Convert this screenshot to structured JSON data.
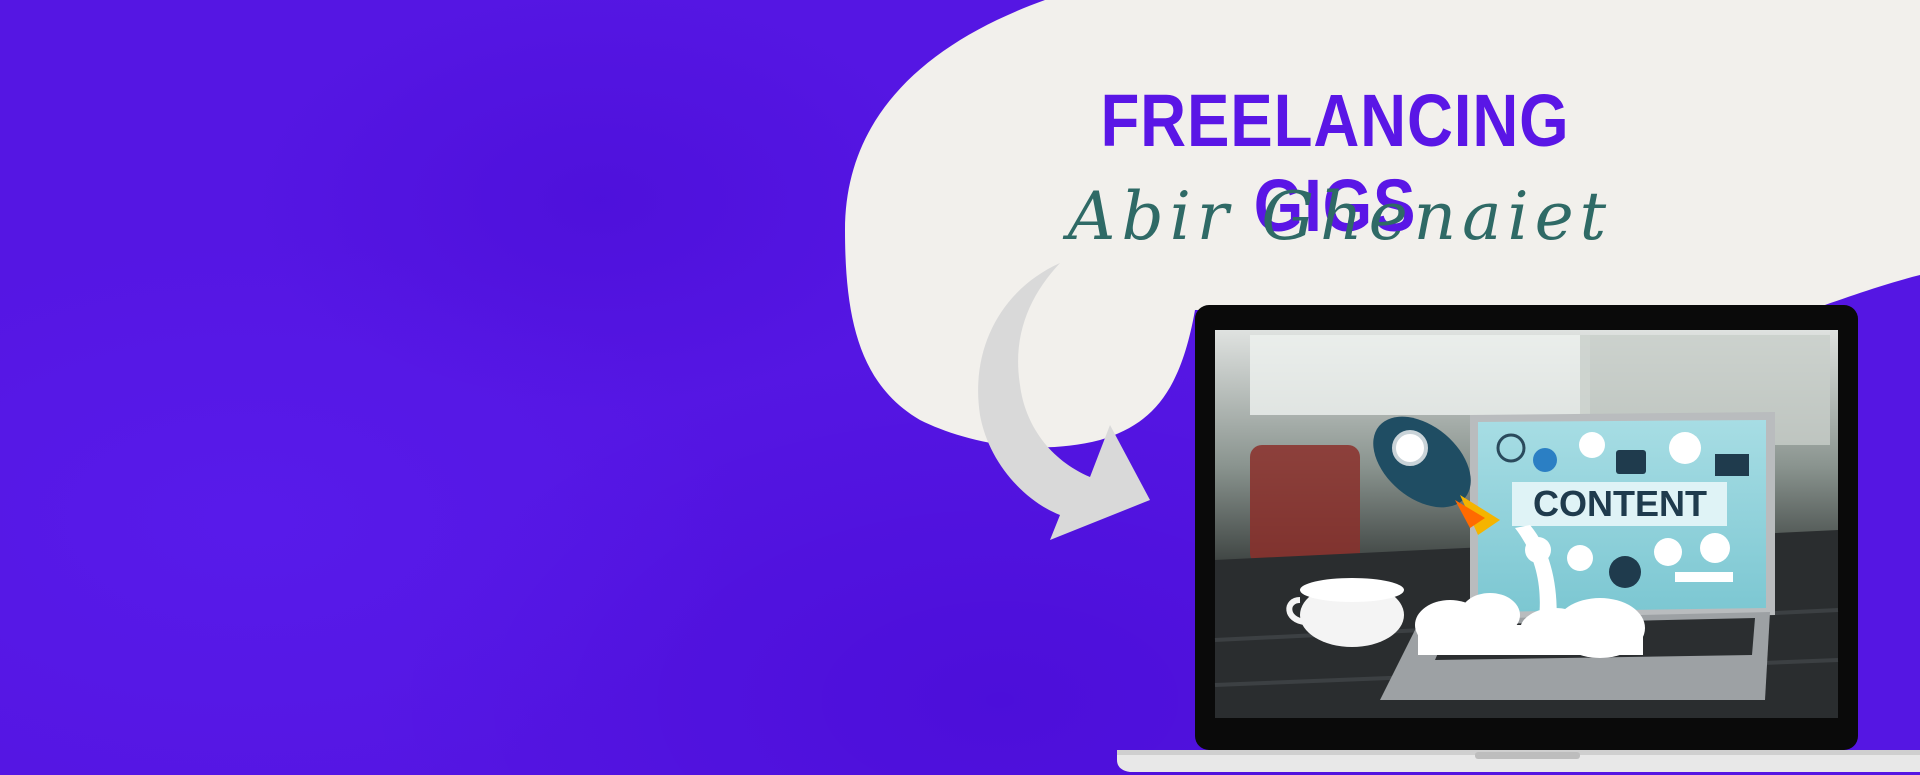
{
  "hero": {
    "title": "FREELANCING GIGS",
    "author": "Abir Ghenaiet"
  },
  "laptop_screen": {
    "image_text": "CONTENT"
  },
  "colors": {
    "background": "#5516e3",
    "bubble": "#f2f0ec",
    "title": "#5a16e6",
    "author": "#2f6a66",
    "arrow": "#d9d9d9"
  },
  "icons": [
    "speech-bubble",
    "curved-arrow",
    "laptop",
    "rocket",
    "coffee-cup",
    "cloud"
  ]
}
